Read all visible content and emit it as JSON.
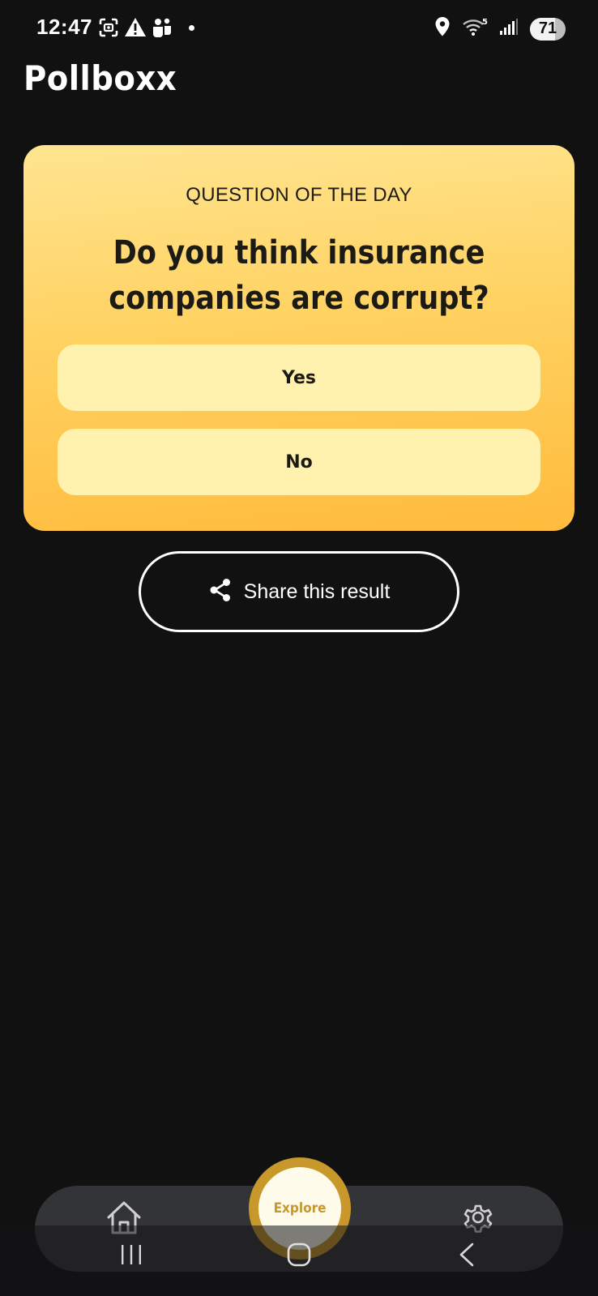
{
  "status_bar": {
    "time": "12:47",
    "battery_level": "71",
    "icons": [
      "screenshot-icon",
      "warning-icon",
      "teams-icon",
      "notification-dot",
      "location-icon",
      "wifi-icon",
      "signal-icon",
      "battery-icon"
    ]
  },
  "header": {
    "title": "Pollboxx"
  },
  "question_card": {
    "label": "QUESTION OF THE DAY",
    "question": "Do you think insurance companies are corrupt?",
    "answers": [
      {
        "label": "Yes"
      },
      {
        "label": "No"
      }
    ]
  },
  "share": {
    "label": "Share this result",
    "icon": "share-icon"
  },
  "bottom_nav": {
    "home_icon": "home-icon",
    "explore_label": "Explore",
    "settings_icon": "gear-icon"
  },
  "system_nav": {
    "icons": [
      "recents-icon",
      "home-button-icon",
      "back-icon"
    ]
  },
  "colors": {
    "background": "#111112",
    "card_gradient_top": "#ffe591",
    "card_gradient_bottom": "#ffbb3c",
    "answer_button": "#fff1ae",
    "accent_gold": "#c8982a",
    "nav_bar": "#333437"
  }
}
